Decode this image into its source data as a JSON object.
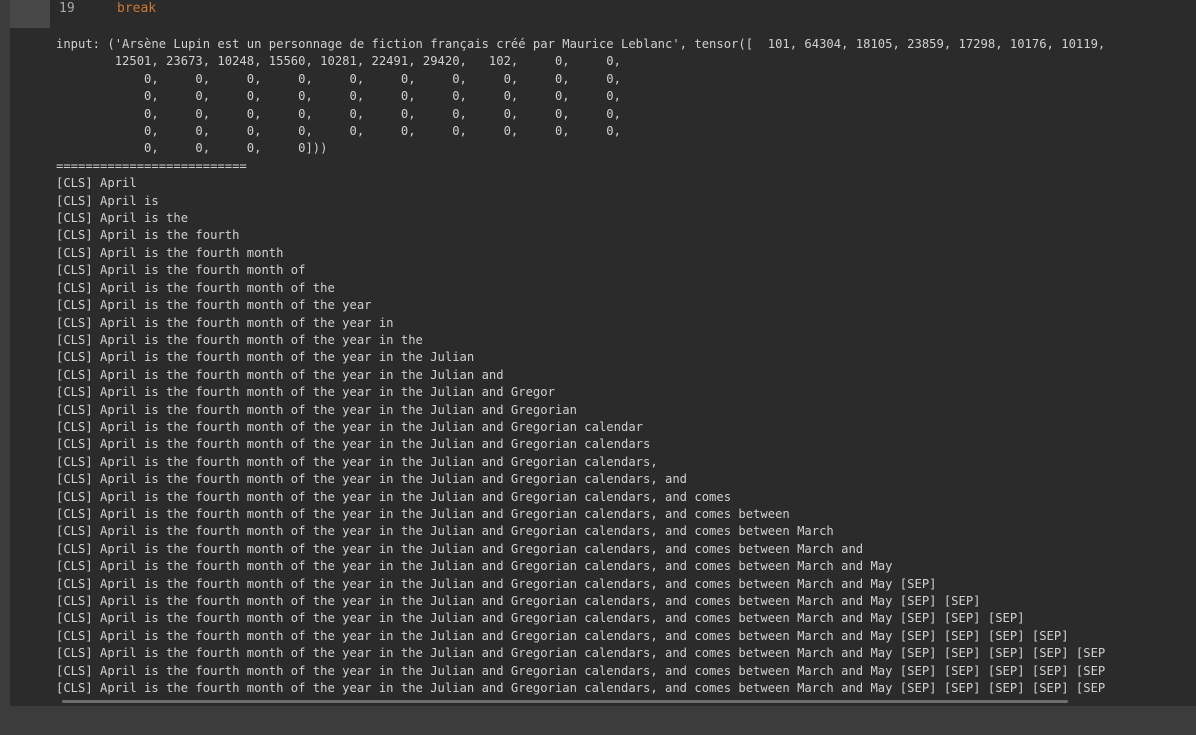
{
  "editor": {
    "line_number": "19",
    "code": "break"
  },
  "output": {
    "input_lines": [
      "input: ('Arsène Lupin est un personnage de fiction français créé par Maurice Leblanc', tensor([  101, 64304, 18105, 23859, 17298, 10176, 10119,",
      "        12501, 23673, 10248, 15560, 10281, 22491, 29420,   102,     0,     0,",
      "            0,     0,     0,     0,     0,     0,     0,     0,     0,     0,",
      "            0,     0,     0,     0,     0,     0,     0,     0,     0,     0,",
      "            0,     0,     0,     0,     0,     0,     0,     0,     0,     0,",
      "            0,     0,     0,     0,     0,     0,     0,     0,     0,     0,",
      "            0,     0,     0,     0]))"
    ],
    "separator": "==========================",
    "generated_lines": [
      "[CLS] April",
      "[CLS] April is",
      "[CLS] April is the",
      "[CLS] April is the fourth",
      "[CLS] April is the fourth month",
      "[CLS] April is the fourth month of",
      "[CLS] April is the fourth month of the",
      "[CLS] April is the fourth month of the year",
      "[CLS] April is the fourth month of the year in",
      "[CLS] April is the fourth month of the year in the",
      "[CLS] April is the fourth month of the year in the Julian",
      "[CLS] April is the fourth month of the year in the Julian and",
      "[CLS] April is the fourth month of the year in the Julian and Gregor",
      "[CLS] April is the fourth month of the year in the Julian and Gregorian",
      "[CLS] April is the fourth month of the year in the Julian and Gregorian calendar",
      "[CLS] April is the fourth month of the year in the Julian and Gregorian calendars",
      "[CLS] April is the fourth month of the year in the Julian and Gregorian calendars,",
      "[CLS] April is the fourth month of the year in the Julian and Gregorian calendars, and",
      "[CLS] April is the fourth month of the year in the Julian and Gregorian calendars, and comes",
      "[CLS] April is the fourth month of the year in the Julian and Gregorian calendars, and comes between",
      "[CLS] April is the fourth month of the year in the Julian and Gregorian calendars, and comes between March",
      "[CLS] April is the fourth month of the year in the Julian and Gregorian calendars, and comes between March and",
      "[CLS] April is the fourth month of the year in the Julian and Gregorian calendars, and comes between March and May",
      "[CLS] April is the fourth month of the year in the Julian and Gregorian calendars, and comes between March and May [SEP]",
      "[CLS] April is the fourth month of the year in the Julian and Gregorian calendars, and comes between March and May [SEP] [SEP]",
      "[CLS] April is the fourth month of the year in the Julian and Gregorian calendars, and comes between March and May [SEP] [SEP] [SEP]",
      "[CLS] April is the fourth month of the year in the Julian and Gregorian calendars, and comes between March and May [SEP] [SEP] [SEP] [SEP]",
      "[CLS] April is the fourth month of the year in the Julian and Gregorian calendars, and comes between March and May [SEP] [SEP] [SEP] [SEP] [SEP",
      "[CLS] April is the fourth month of the year in the Julian and Gregorian calendars, and comes between March and May [SEP] [SEP] [SEP] [SEP] [SEP",
      "[CLS] April is the fourth month of the year in the Julian and Gregorian calendars, and comes between March and May [SEP] [SEP] [SEP] [SEP] [SEP"
    ]
  },
  "colors": {
    "background": "#3c3c3c",
    "cell_background": "#2b2b2b",
    "gutter": "#484848",
    "keyword": "#cc7832",
    "output_text": "#d0d0d0"
  }
}
